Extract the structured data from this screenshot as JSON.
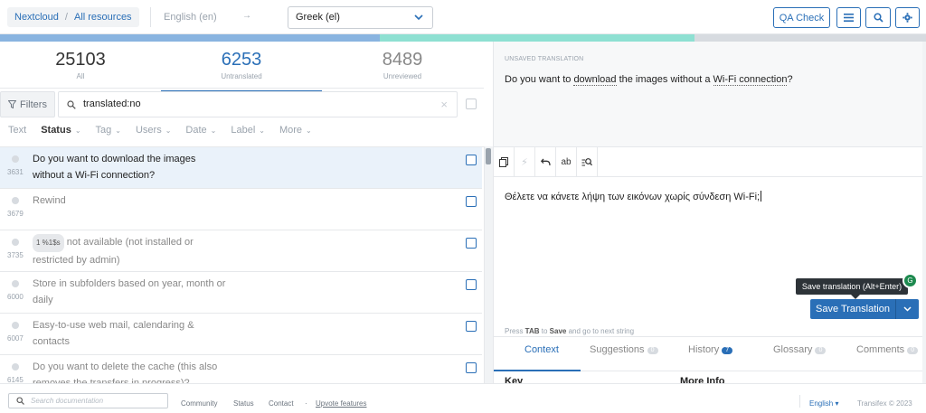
{
  "header": {
    "breadcrumb": [
      "Nextcloud",
      "All resources"
    ],
    "breadcrumb_sep": "/",
    "source_language": "English (en)",
    "arrow": "→",
    "target_language": "Greek (el)",
    "qa_check_label": "QA Check"
  },
  "stats": [
    {
      "count": "25103",
      "label": "All"
    },
    {
      "count": "6253",
      "label": "Untranslated"
    },
    {
      "count": "8489",
      "label": "Unreviewed"
    }
  ],
  "filters": {
    "filters_label": "Filters",
    "search_value": "translated:no",
    "clear": "×"
  },
  "sort_options": [
    "Text",
    "Status",
    "Tag",
    "Users",
    "Date",
    "Label",
    "More"
  ],
  "strings": [
    {
      "line1": "Do you want to download the images",
      "line2": "without a Wi-Fi connection?",
      "id": "3631",
      "selected": true
    },
    {
      "line1": "Rewind",
      "line2": "",
      "id": "3679",
      "selected": false
    },
    {
      "badge": "1 %1$s",
      "line1": " not available (not installed or",
      "line2": "restricted by admin)",
      "id": "3735",
      "selected": false
    },
    {
      "line1": "Store in subfolders based on year, month or",
      "line2": "daily",
      "id": "6000",
      "selected": false
    },
    {
      "line1": "Easy-to-use web mail, calendaring &",
      "line2": "contacts",
      "id": "6007",
      "selected": false
    },
    {
      "line1": "Do you want to delete the cache (this also",
      "line2": "removes the transfers in progress)?",
      "id": "6145",
      "selected": false
    }
  ],
  "editor": {
    "unsaved_label": "UNSAVED TRANSLATION",
    "source_before": "Do you want to ",
    "source_download": "download",
    "source_mid": " the images without a ",
    "source_wifi": "Wi-Fi connection",
    "source_after": "?",
    "translation": "Θέλετε να κάνετε λήψη των εικόνων χωρίς σύνδεση Wi-Fi;",
    "tooltip": "Save translation (Alt+Enter)",
    "save_label": "Save Translation",
    "hint_press": "Press ",
    "hint_tab": "TAB",
    "hint_to": " to ",
    "hint_save": "Save",
    "hint_rest": " and go to next string",
    "green_badge": "G"
  },
  "tabs": [
    {
      "label": "Context",
      "count": ""
    },
    {
      "label": "Suggestions",
      "count": "0"
    },
    {
      "label": "History",
      "count": "7"
    },
    {
      "label": "Glossary",
      "count": "0"
    },
    {
      "label": "Comments",
      "count": "0"
    }
  ],
  "context_columns": [
    "Key",
    "More Info"
  ],
  "footer": {
    "search_placeholder": "Search documentation",
    "links": [
      "Community",
      "Status",
      "Contact",
      "·",
      "Upvote features"
    ],
    "language": "English",
    "copyright": "Transifex © 2023"
  },
  "progress": {
    "translated_fraction": 0.41,
    "reviewed_fraction": 0.34
  },
  "colors": {
    "accent": "#2a6fb7",
    "progress_blue": "#89b4e0",
    "progress_teal": "#8ee0d2",
    "progress_grey": "#d7dbe0"
  }
}
